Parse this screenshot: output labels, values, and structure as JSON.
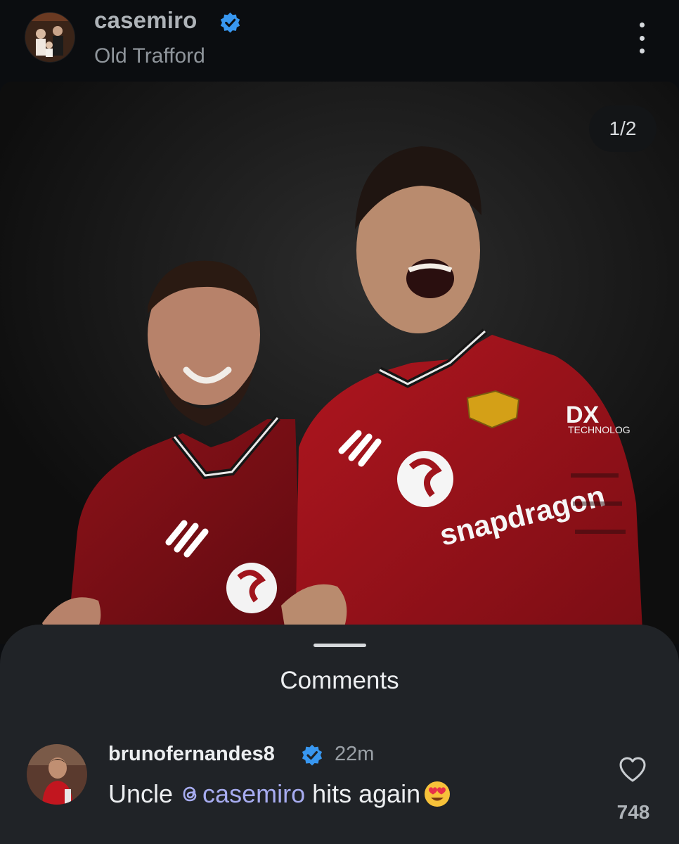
{
  "post": {
    "username": "casemiro",
    "verified": true,
    "location": "Old Trafford",
    "more_icon": "more-vertical-icon",
    "image": {
      "counter": "1/2",
      "jersey_sponsor": "snapdragon",
      "sleeve_sponsor": "TECHNOLOG"
    }
  },
  "comments": {
    "title": "Comments",
    "items": [
      {
        "username": "brunofernandes8",
        "verified": true,
        "time": "22m",
        "text_before": "Uncle ",
        "mention": "casemiro",
        "text_after": " hits again",
        "emoji": "heart-eyes-emoji",
        "likes": "748",
        "like_icon": "heart-outline-icon"
      }
    ]
  },
  "colors": {
    "background": "#0b0d10",
    "sheet": "#202327",
    "verified": "#3897f0",
    "mention": "#a7acf0",
    "jersey_red": "#a0141c"
  }
}
